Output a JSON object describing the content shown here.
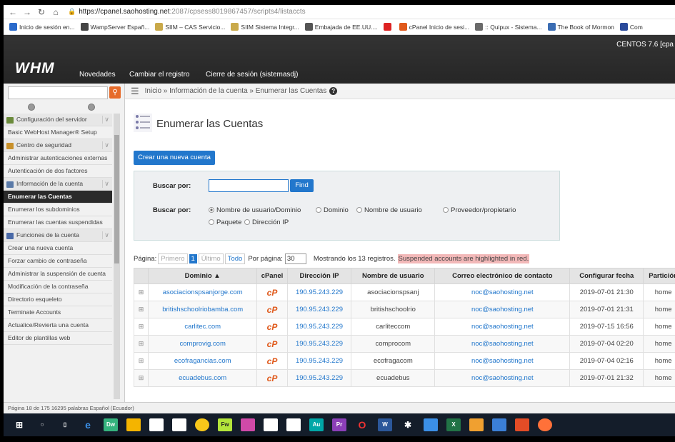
{
  "browser": {
    "url_host": "https://cpanel.saohosting.net",
    "url_rest": ":2087/cpsess8019867457/scripts4/listaccts",
    "bookmarks": [
      {
        "label": "Inicio de sesión en...",
        "color": "#2a6acb"
      },
      {
        "label": "WampServer Españ...",
        "color": "#444"
      },
      {
        "label": "SIIM – CAS Servicio...",
        "color": "#c9a94a"
      },
      {
        "label": "SIIM Sistema Integr...",
        "color": "#c9a94a"
      },
      {
        "label": "Embajada de EE.UU....",
        "color": "#555"
      },
      {
        "label": "",
        "color": "#d22"
      },
      {
        "label": "cPanel Inicio de sesi...",
        "color": "#e05a1c"
      },
      {
        "label": ":: Quipux - Sistema...",
        "color": "#6a6a6a"
      },
      {
        "label": "The Book of Mormon",
        "color": "#3b6db3"
      },
      {
        "label": "Com",
        "color": "#2a4a9b"
      }
    ]
  },
  "header": {
    "logo": "WHM",
    "menu": [
      "Novedades",
      "Cambiar el registro",
      "Cierre de sesión (sistemasdj)"
    ],
    "os": "CENTOS 7.6 [cpa"
  },
  "sidebar": {
    "items": [
      {
        "label": "Configuración del servidor",
        "type": "cat",
        "color": "#6a8a3a"
      },
      {
        "label": "Basic WebHost Manager® Setup",
        "type": "plain"
      },
      {
        "label": "Centro de seguridad",
        "type": "cat",
        "color": "#c8902a"
      },
      {
        "label": "Administrar autenticaciones externas",
        "type": "plain"
      },
      {
        "label": "Autenticación de dos factores",
        "type": "plain"
      },
      {
        "label": "Información de la cuenta",
        "type": "cat",
        "color": "#5a7aa8"
      },
      {
        "label": "Enumerar las Cuentas",
        "type": "act"
      },
      {
        "label": "Enumerar los subdominios",
        "type": "plain"
      },
      {
        "label": "Enumerar las cuentas suspendidas",
        "type": "plain"
      },
      {
        "label": "Funciones de la cuenta",
        "type": "cat",
        "color": "#4a6aa8"
      },
      {
        "label": "Crear una nueva cuenta",
        "type": "plain"
      },
      {
        "label": "Forzar cambio de contraseña",
        "type": "plain"
      },
      {
        "label": "Administrar la suspensión de cuenta",
        "type": "plain"
      },
      {
        "label": "Modificación de la contraseña",
        "type": "plain"
      },
      {
        "label": "Directorio esqueleto",
        "type": "plain"
      },
      {
        "label": "Terminate Accounts",
        "type": "plain"
      },
      {
        "label": "Actualice/Revierta una cuenta",
        "type": "plain"
      },
      {
        "label": "Editor de plantillas web",
        "type": "plain"
      }
    ]
  },
  "breadcrumb": "Inicio » Información de la cuenta » Enumerar las Cuentas",
  "page": {
    "title": "Enumerar las Cuentas",
    "create_btn": "Crear una nueva cuenta",
    "search_label": "Buscar por:",
    "find_btn": "Find",
    "search_options": [
      "Nombre de usuario/Dominio",
      "Dominio",
      "Nombre de usuario",
      "Proveedor/propietario",
      "Paquete",
      "Dirección IP"
    ],
    "pager": {
      "page_label": "Página:",
      "first": "Primero",
      "current": "1",
      "last": "Último",
      "all": "Todo",
      "per_page_label": "Por página:",
      "per_page": "30",
      "showing": "Mostrando los 13 registros.",
      "suspended_note": "Suspended accounts are highlighted in red."
    }
  },
  "table": {
    "headers": [
      "Dominio ▲",
      "cPanel",
      "Dirección IP",
      "Nombre de usuario",
      "Correo electrónico de contacto",
      "Configurar fecha",
      "Partición"
    ],
    "rows": [
      [
        "asociacionspsanjorge.com",
        "190.95.243.229",
        "asociacionspsanj",
        "noc@saohosting.net",
        "2019-07-01 21:30",
        "home"
      ],
      [
        "britishschoolriobamba.com",
        "190.95.243.229",
        "britishschoolrio",
        "noc@saohosting.net",
        "2019-07-01 21:31",
        "home"
      ],
      [
        "carlitec.com",
        "190.95.243.229",
        "carliteccom",
        "noc@saohosting.net",
        "2019-07-15 16:56",
        "home"
      ],
      [
        "comprovig.com",
        "190.95.243.229",
        "comprocom",
        "noc@saohosting.net",
        "2019-07-04 02:20",
        "home"
      ],
      [
        "ecofragancias.com",
        "190.95.243.229",
        "ecofragacom",
        "noc@saohosting.net",
        "2019-07-04 02:16",
        "home"
      ],
      [
        "ecuadebus.com",
        "190.95.243.229",
        "ecuadebus",
        "noc@saohosting.net",
        "2019-07-01 21:32",
        "home"
      ]
    ]
  },
  "status": "Página 18 de 175   16295 palabras   Español (Ecuador)"
}
